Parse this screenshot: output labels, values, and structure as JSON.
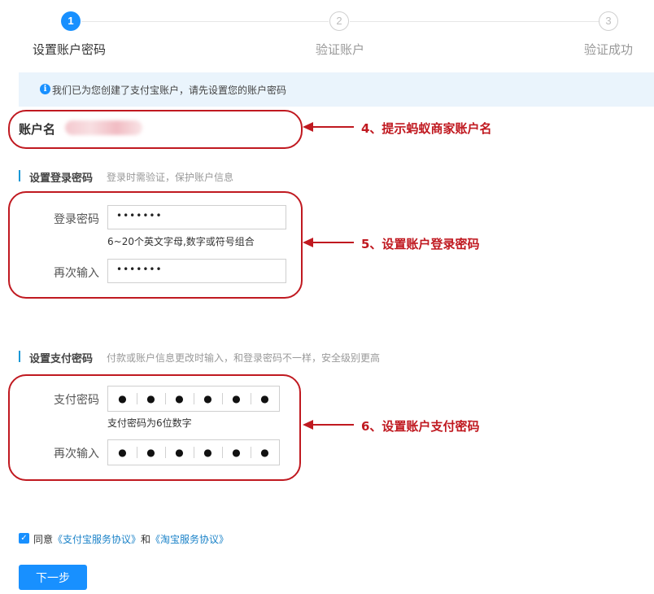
{
  "stepper": {
    "steps": [
      {
        "number": "1",
        "label": "设置账户密码",
        "state": "active"
      },
      {
        "number": "2",
        "label": "验证账户",
        "state": "inactive"
      },
      {
        "number": "3",
        "label": "验证成功",
        "state": "inactive"
      }
    ]
  },
  "banner": {
    "icon": "info-icon",
    "icon_glyph": "i",
    "text": "我们已为您创建了支付宝账户，请先设置您的账户密码"
  },
  "account": {
    "label": "账户名"
  },
  "login_section": {
    "title": "设置登录密码",
    "desc": "登录时需验证，保护账户信息",
    "password_label": "登录密码",
    "password_value": "•••••••",
    "hint": "6~20个英文字母,数字或符号组合",
    "confirm_label": "再次输入",
    "confirm_value": "•••••••"
  },
  "pay_section": {
    "title": "设置支付密码",
    "desc": "付款或账户信息更改时输入，和登录密码不一样，安全级别更高",
    "password_label": "支付密码",
    "password_digits": [
      "●",
      "●",
      "●",
      "●",
      "●",
      "●"
    ],
    "hint": "支付密码为6位数字",
    "confirm_label": "再次输入",
    "confirm_digits": [
      "●",
      "●",
      "●",
      "●",
      "●",
      "●"
    ]
  },
  "annotations": {
    "a4": "4、提示蚂蚁商家账户名",
    "a5": "5、设置账户登录密码",
    "a6": "6、设置账户支付密码",
    "color": "#c01920"
  },
  "agreement": {
    "checkmark": "✓",
    "prefix": "同意",
    "link1": "《支付宝服务协议》",
    "and": "和",
    "link2": "《淘宝服务协议》"
  },
  "next_button": {
    "label": "下一步"
  },
  "colors": {
    "primary": "#1890ff",
    "banner_bg": "#eaf4fc",
    "section_bar": "#1a98d6"
  }
}
